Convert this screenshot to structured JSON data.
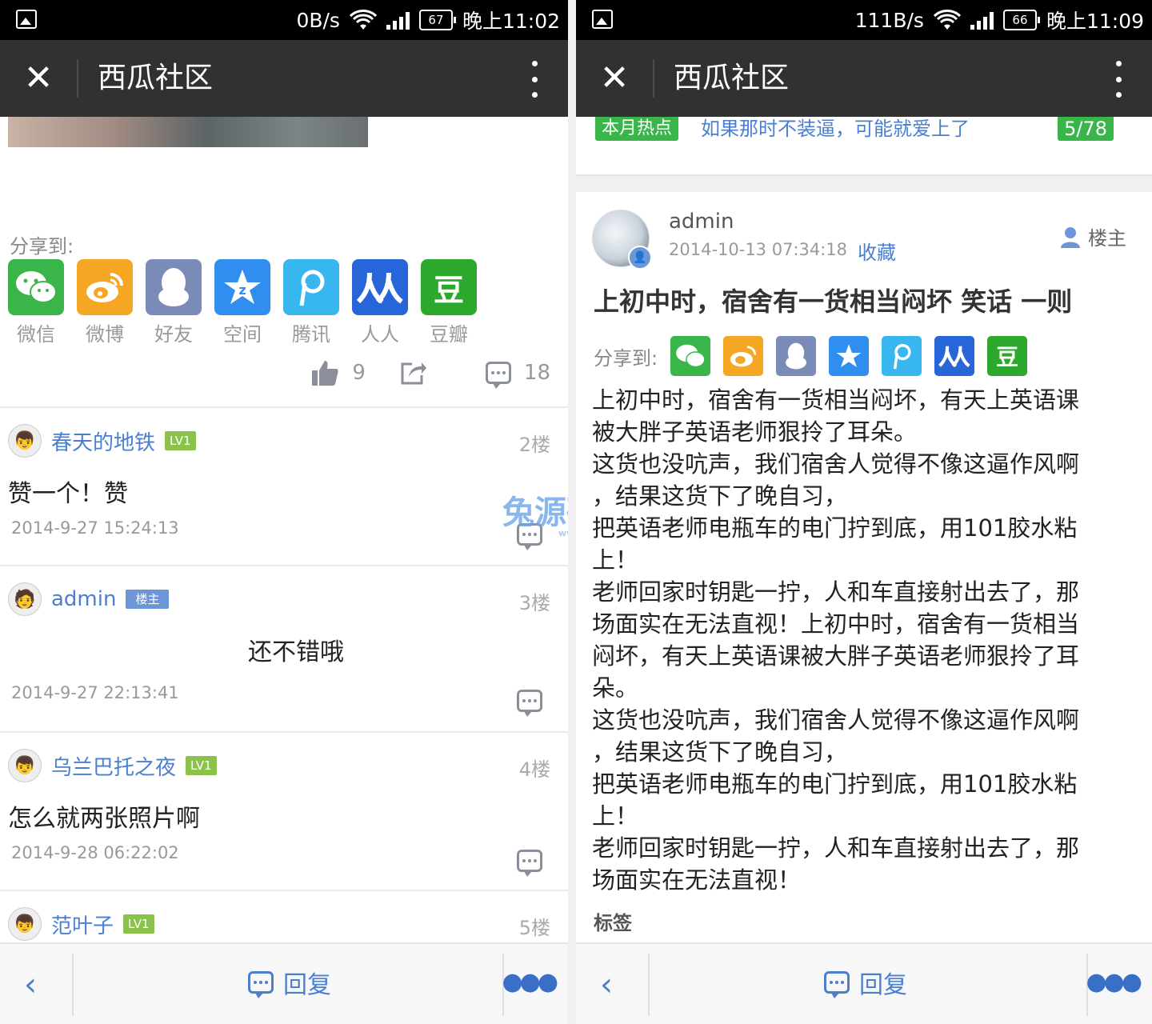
{
  "left": {
    "status": {
      "speed": "0B/s",
      "battery": "67",
      "time": "晚上11:02"
    },
    "title": "西瓜社区",
    "share": {
      "label": "分享到:",
      "items": [
        {
          "name": "微信",
          "color": "#3ab54a",
          "icon": "wechat-icon"
        },
        {
          "name": "微博",
          "color": "#f5a623",
          "icon": "weibo-icon"
        },
        {
          "name": "好友",
          "color": "#7b8bb8",
          "icon": "qq-icon"
        },
        {
          "name": "空间",
          "color": "#2f8ef0",
          "icon": "qzone-icon"
        },
        {
          "name": "腾讯",
          "color": "#38b6f0",
          "icon": "tencent-weibo-icon"
        },
        {
          "name": "人人",
          "color": "#2865d8",
          "icon": "renren-icon"
        },
        {
          "name": "豆瓣",
          "color": "#2ca92c",
          "icon": "douban-icon",
          "glyph": "豆"
        }
      ]
    },
    "stats": {
      "likes": "9",
      "comments": "18"
    },
    "comments": [
      {
        "user": "春天的地铁",
        "badge": "LV1",
        "badge_type": "lv",
        "floor": "2楼",
        "text": "赞一个！赞",
        "time": "2014-9-27 15:24:13",
        "align": "left"
      },
      {
        "user": "admin",
        "badge": "楼主",
        "badge_type": "owner",
        "floor": "3楼",
        "text": "还不错哦",
        "time": "2014-9-27 22:13:41",
        "align": "center"
      },
      {
        "user": "乌兰巴托之夜",
        "badge": "LV1",
        "badge_type": "lv",
        "floor": "4楼",
        "text": "怎么就两张照片啊",
        "time": "2014-9-28 06:22:02",
        "align": "left"
      },
      {
        "user": "范叶子",
        "badge": "LV1",
        "badge_type": "lv",
        "floor": "5楼",
        "text": "",
        "time": "",
        "align": "left"
      }
    ],
    "watermark": {
      "text": "兔源码",
      "sub": "www.tuyuanma.com"
    },
    "bottom": {
      "reply": "回复"
    }
  },
  "right": {
    "status": {
      "speed": "111B/s",
      "battery": "66",
      "time": "晚上11:09"
    },
    "title": "西瓜社区",
    "hot": {
      "tag": "本月热点",
      "text": "如果那时不装逼，可能就爱上了",
      "count": "5/78"
    },
    "post": {
      "author": "admin",
      "date": "2014-10-13 07:34:18",
      "favorite": "收藏",
      "owner_label": "楼主",
      "title": "上初中时，宿舍有一货相当闷坏 笑话 一则",
      "share_label": "分享到:",
      "body": [
        "上初中时，宿舍有一货相当闷坏，有天上英语课",
        "被大胖子英语老师狠拎了耳朵。",
        "这货也没吭声，我们宿舍人觉得不像这逼作风啊",
        "，结果这货下了晚自习，",
        "把英语老师电瓶车的电门拧到底，用101胶水粘",
        "上！",
        "老师回家时钥匙一拧，人和车直接射出去了，那",
        "场面实在无法直视！上初中时，宿舍有一货相当",
        "闷坏，有天上英语课被大胖子英语老师狠拎了耳",
        "朵。",
        "这货也没吭声，我们宿舍人觉得不像这逼作风啊",
        "，结果这货下了晚自习，",
        "把英语老师电瓶车的电门拧到底，用101胶水粘",
        "上！",
        "老师回家时钥匙一拧，人和车直接射出去了，那",
        "场面实在无法直视！"
      ],
      "tags_label": "标签"
    },
    "bottom": {
      "reply": "回复"
    }
  }
}
